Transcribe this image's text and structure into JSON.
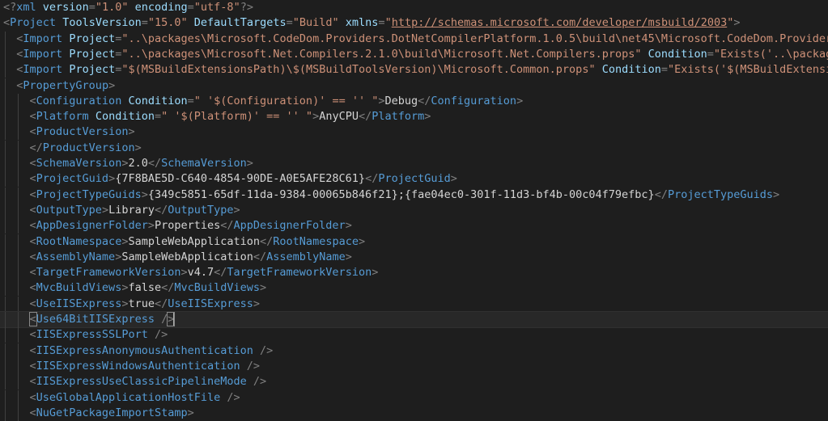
{
  "editor": {
    "language": "xml",
    "theme_colors": {
      "background": "#1e1e1e",
      "tag": "#569cd6",
      "attribute": "#9cdcfe",
      "string": "#ce9178",
      "text": "#d4d4d4",
      "punctuation": "#808080"
    },
    "current_line": 20,
    "lines": [
      {
        "indent": 0,
        "tokens": [
          [
            "p",
            "<?"
          ],
          [
            "t",
            "xml"
          ],
          [
            "x",
            " "
          ],
          [
            "a",
            "version"
          ],
          [
            "p",
            "="
          ],
          [
            "s",
            "\"1.0\""
          ],
          [
            "x",
            " "
          ],
          [
            "a",
            "encoding"
          ],
          [
            "p",
            "="
          ],
          [
            "s",
            "\"utf-8\""
          ],
          [
            "p",
            "?>"
          ]
        ]
      },
      {
        "indent": 0,
        "tokens": [
          [
            "p",
            "<"
          ],
          [
            "t",
            "Project"
          ],
          [
            "x",
            " "
          ],
          [
            "a",
            "ToolsVersion"
          ],
          [
            "p",
            "="
          ],
          [
            "s",
            "\"15.0\""
          ],
          [
            "x",
            " "
          ],
          [
            "a",
            "DefaultTargets"
          ],
          [
            "p",
            "="
          ],
          [
            "s",
            "\"Build\""
          ],
          [
            "x",
            " "
          ],
          [
            "a",
            "xmlns"
          ],
          [
            "p",
            "="
          ],
          [
            "s",
            "\""
          ],
          [
            "u",
            "http://schemas.microsoft.com/developer/msbuild/2003"
          ],
          [
            "s",
            "\""
          ],
          [
            "p",
            ">"
          ]
        ]
      },
      {
        "indent": 1,
        "tokens": [
          [
            "p",
            "<"
          ],
          [
            "t",
            "Import"
          ],
          [
            "x",
            " "
          ],
          [
            "a",
            "Project"
          ],
          [
            "p",
            "="
          ],
          [
            "s",
            "\"..\\packages\\Microsoft.CodeDom.Providers.DotNetCompilerPlatform.1.0.5\\build\\net45\\Microsoft.CodeDom.Providers.Do"
          ]
        ]
      },
      {
        "indent": 1,
        "tokens": [
          [
            "p",
            "<"
          ],
          [
            "t",
            "Import"
          ],
          [
            "x",
            " "
          ],
          [
            "a",
            "Project"
          ],
          [
            "p",
            "="
          ],
          [
            "s",
            "\"..\\packages\\Microsoft.Net.Compilers.2.1.0\\build\\Microsoft.Net.Compilers.props\""
          ],
          [
            "x",
            " "
          ],
          [
            "a",
            "Condition"
          ],
          [
            "p",
            "="
          ],
          [
            "s",
            "\"Exists('..\\packages\\M"
          ]
        ]
      },
      {
        "indent": 1,
        "tokens": [
          [
            "p",
            "<"
          ],
          [
            "t",
            "Import"
          ],
          [
            "x",
            " "
          ],
          [
            "a",
            "Project"
          ],
          [
            "p",
            "="
          ],
          [
            "s",
            "\"$(MSBuildExtensionsPath)\\$(MSBuildToolsVersion)\\Microsoft.Common.props\""
          ],
          [
            "x",
            " "
          ],
          [
            "a",
            "Condition"
          ],
          [
            "p",
            "="
          ],
          [
            "s",
            "\"Exists('$(MSBuildExtensionsP"
          ]
        ]
      },
      {
        "indent": 1,
        "tokens": [
          [
            "p",
            "<"
          ],
          [
            "t",
            "PropertyGroup"
          ],
          [
            "p",
            ">"
          ]
        ]
      },
      {
        "indent": 2,
        "tokens": [
          [
            "p",
            "<"
          ],
          [
            "t",
            "Configuration"
          ],
          [
            "x",
            " "
          ],
          [
            "a",
            "Condition"
          ],
          [
            "p",
            "="
          ],
          [
            "s",
            "\" '$(Configuration)' == '' \""
          ],
          [
            "p",
            ">"
          ],
          [
            "x",
            "Debug"
          ],
          [
            "p",
            "</"
          ],
          [
            "t",
            "Configuration"
          ],
          [
            "p",
            ">"
          ]
        ]
      },
      {
        "indent": 2,
        "tokens": [
          [
            "p",
            "<"
          ],
          [
            "t",
            "Platform"
          ],
          [
            "x",
            " "
          ],
          [
            "a",
            "Condition"
          ],
          [
            "p",
            "="
          ],
          [
            "s",
            "\" '$(Platform)' == '' \""
          ],
          [
            "p",
            ">"
          ],
          [
            "x",
            "AnyCPU"
          ],
          [
            "p",
            "</"
          ],
          [
            "t",
            "Platform"
          ],
          [
            "p",
            ">"
          ]
        ]
      },
      {
        "indent": 2,
        "tokens": [
          [
            "p",
            "<"
          ],
          [
            "t",
            "ProductVersion"
          ],
          [
            "p",
            ">"
          ]
        ]
      },
      {
        "indent": 2,
        "tokens": [
          [
            "p",
            "</"
          ],
          [
            "t",
            "ProductVersion"
          ],
          [
            "p",
            ">"
          ]
        ]
      },
      {
        "indent": 2,
        "tokens": [
          [
            "p",
            "<"
          ],
          [
            "t",
            "SchemaVersion"
          ],
          [
            "p",
            ">"
          ],
          [
            "x",
            "2.0"
          ],
          [
            "p",
            "</"
          ],
          [
            "t",
            "SchemaVersion"
          ],
          [
            "p",
            ">"
          ]
        ]
      },
      {
        "indent": 2,
        "tokens": [
          [
            "p",
            "<"
          ],
          [
            "t",
            "ProjectGuid"
          ],
          [
            "p",
            ">"
          ],
          [
            "x",
            "{7F8BAE5D-C640-4854-90DE-A0E5AFE28C61}"
          ],
          [
            "p",
            "</"
          ],
          [
            "t",
            "ProjectGuid"
          ],
          [
            "p",
            ">"
          ]
        ]
      },
      {
        "indent": 2,
        "tokens": [
          [
            "p",
            "<"
          ],
          [
            "t",
            "ProjectTypeGuids"
          ],
          [
            "p",
            ">"
          ],
          [
            "x",
            "{349c5851-65df-11da-9384-00065b846f21};{fae04ec0-301f-11d3-bf4b-00c04f79efbc}"
          ],
          [
            "p",
            "</"
          ],
          [
            "t",
            "ProjectTypeGuids"
          ],
          [
            "p",
            ">"
          ]
        ]
      },
      {
        "indent": 2,
        "tokens": [
          [
            "p",
            "<"
          ],
          [
            "t",
            "OutputType"
          ],
          [
            "p",
            ">"
          ],
          [
            "x",
            "Library"
          ],
          [
            "p",
            "</"
          ],
          [
            "t",
            "OutputType"
          ],
          [
            "p",
            ">"
          ]
        ]
      },
      {
        "indent": 2,
        "tokens": [
          [
            "p",
            "<"
          ],
          [
            "t",
            "AppDesignerFolder"
          ],
          [
            "p",
            ">"
          ],
          [
            "x",
            "Properties"
          ],
          [
            "p",
            "</"
          ],
          [
            "t",
            "AppDesignerFolder"
          ],
          [
            "p",
            ">"
          ]
        ]
      },
      {
        "indent": 2,
        "tokens": [
          [
            "p",
            "<"
          ],
          [
            "t",
            "RootNamespace"
          ],
          [
            "p",
            ">"
          ],
          [
            "x",
            "SampleWebApplication"
          ],
          [
            "p",
            "</"
          ],
          [
            "t",
            "RootNamespace"
          ],
          [
            "p",
            ">"
          ]
        ]
      },
      {
        "indent": 2,
        "tokens": [
          [
            "p",
            "<"
          ],
          [
            "t",
            "AssemblyName"
          ],
          [
            "p",
            ">"
          ],
          [
            "x",
            "SampleWebApplication"
          ],
          [
            "p",
            "</"
          ],
          [
            "t",
            "AssemblyName"
          ],
          [
            "p",
            ">"
          ]
        ]
      },
      {
        "indent": 2,
        "tokens": [
          [
            "p",
            "<"
          ],
          [
            "t",
            "TargetFrameworkVersion"
          ],
          [
            "p",
            ">"
          ],
          [
            "x",
            "v4.7"
          ],
          [
            "p",
            "</"
          ],
          [
            "t",
            "TargetFrameworkVersion"
          ],
          [
            "p",
            ">"
          ]
        ]
      },
      {
        "indent": 2,
        "tokens": [
          [
            "p",
            "<"
          ],
          [
            "t",
            "MvcBuildViews"
          ],
          [
            "p",
            ">"
          ],
          [
            "x",
            "false"
          ],
          [
            "p",
            "</"
          ],
          [
            "t",
            "MvcBuildViews"
          ],
          [
            "p",
            ">"
          ]
        ]
      },
      {
        "indent": 2,
        "tokens": [
          [
            "p",
            "<"
          ],
          [
            "t",
            "UseIISExpress"
          ],
          [
            "p",
            ">"
          ],
          [
            "x",
            "true"
          ],
          [
            "p",
            "</"
          ],
          [
            "t",
            "UseIISExpress"
          ],
          [
            "p",
            ">"
          ]
        ]
      },
      {
        "indent": 2,
        "tokens": [
          [
            "b",
            "<"
          ],
          [
            "t",
            "Use64BitIISExpress"
          ],
          [
            "x",
            " "
          ],
          [
            "p",
            "/"
          ],
          [
            "c",
            ">"
          ]
        ]
      },
      {
        "indent": 2,
        "tokens": [
          [
            "p",
            "<"
          ],
          [
            "t",
            "IISExpressSSLPort"
          ],
          [
            "x",
            " "
          ],
          [
            "p",
            "/>"
          ]
        ]
      },
      {
        "indent": 2,
        "tokens": [
          [
            "p",
            "<"
          ],
          [
            "t",
            "IISExpressAnonymousAuthentication"
          ],
          [
            "x",
            " "
          ],
          [
            "p",
            "/>"
          ]
        ]
      },
      {
        "indent": 2,
        "tokens": [
          [
            "p",
            "<"
          ],
          [
            "t",
            "IISExpressWindowsAuthentication"
          ],
          [
            "x",
            " "
          ],
          [
            "p",
            "/>"
          ]
        ]
      },
      {
        "indent": 2,
        "tokens": [
          [
            "p",
            "<"
          ],
          [
            "t",
            "IISExpressUseClassicPipelineMode"
          ],
          [
            "x",
            " "
          ],
          [
            "p",
            "/>"
          ]
        ]
      },
      {
        "indent": 2,
        "tokens": [
          [
            "p",
            "<"
          ],
          [
            "t",
            "UseGlobalApplicationHostFile"
          ],
          [
            "x",
            " "
          ],
          [
            "p",
            "/>"
          ]
        ]
      },
      {
        "indent": 2,
        "tokens": [
          [
            "p",
            "<"
          ],
          [
            "t",
            "NuGetPackageImportStamp"
          ],
          [
            "p",
            ">"
          ]
        ]
      }
    ]
  }
}
